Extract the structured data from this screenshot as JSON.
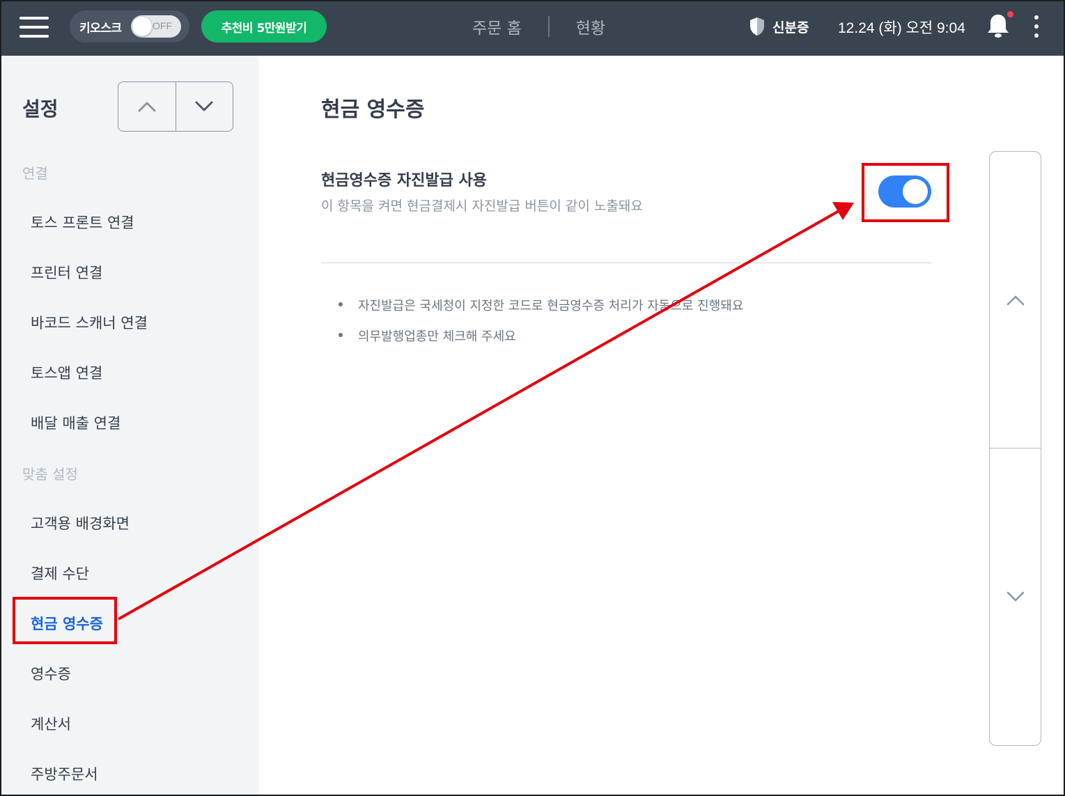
{
  "topbar": {
    "kiosk_label": "키오스크",
    "kiosk_state": "OFF",
    "promo_label": "추천비 5만원받기",
    "tabs": [
      {
        "label": "주문 홈"
      },
      {
        "label": "현황"
      }
    ],
    "id_card_label": "신분증",
    "datetime": "12.24 (화) 오전 9:04",
    "notification_dot_color": "#f04452"
  },
  "sidebar": {
    "title": "설정",
    "sections": [
      {
        "label": "연결",
        "items": [
          {
            "label": "토스 프론트 연결"
          },
          {
            "label": "프린터 연결"
          },
          {
            "label": "바코드 스캐너 연결"
          },
          {
            "label": "토스앱 연결"
          },
          {
            "label": "배달 매출 연결"
          }
        ]
      },
      {
        "label": "맞춤 설정",
        "items": [
          {
            "label": "고객용 배경화면"
          },
          {
            "label": "결제 수단"
          },
          {
            "label": "현금 영수증",
            "active": true
          },
          {
            "label": "영수증"
          },
          {
            "label": "계산서"
          },
          {
            "label": "주방주문서"
          }
        ]
      }
    ]
  },
  "main": {
    "title": "현금 영수증",
    "setting": {
      "title": "현금영수증 자진발급 사용",
      "description": "이 항목을 켜면 현금결제시 자진발급 버튼이 같이 노출돼요",
      "enabled": true
    },
    "notes": [
      "자진발급은 국세청이 지정한 코드로 현금영수증 처리가 자동으로 진행돼요",
      "의무발행업종만 체크해 주세요"
    ]
  },
  "colors": {
    "topbar_bg": "#3a4450",
    "promo_green": "#12b76a",
    "toggle_blue": "#3182f6",
    "active_text": "#1b64da",
    "annotation_red": "#e3000f"
  }
}
